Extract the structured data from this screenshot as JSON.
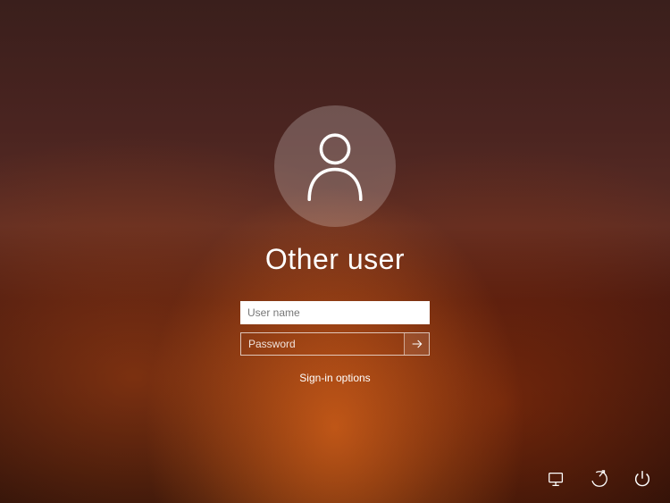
{
  "title": "Other user",
  "fields": {
    "username_placeholder": "User name",
    "username_value": "",
    "password_placeholder": "Password",
    "password_value": ""
  },
  "signin_options_label": "Sign-in options",
  "tray": {
    "network": "network-icon",
    "ease_of_access": "ease-of-access-icon",
    "power": "power-icon"
  }
}
